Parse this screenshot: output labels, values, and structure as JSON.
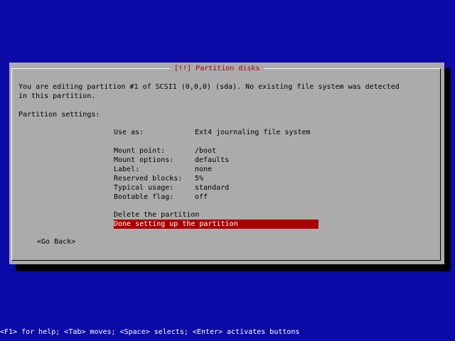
{
  "dialog": {
    "title": "[!!] Partition disks",
    "intro_line1": "You are editing partition #1 of SCSI1 (0,0,0) (sda). No existing file system was detected",
    "intro_line2": "in this partition.",
    "settings_heading": "Partition settings:",
    "options": [
      {
        "label": "Use as:",
        "value": "Ext4 journaling file system"
      },
      {
        "label": "Mount point:",
        "value": "/boot"
      },
      {
        "label": "Mount options:",
        "value": "defaults"
      },
      {
        "label": "Label:",
        "value": "none"
      },
      {
        "label": "Reserved blocks:",
        "value": "5%"
      },
      {
        "label": "Typical usage:",
        "value": "standard"
      },
      {
        "label": "Bootable flag:",
        "value": "off"
      }
    ],
    "actions": [
      {
        "label": "Delete the partition",
        "selected": false
      },
      {
        "label": "Done setting up the partition",
        "selected": true
      }
    ],
    "go_back": "<Go Back>"
  },
  "status_bar": {
    "help_text": "<F1> for help; <Tab> moves; <Space> selects; <Enter> activates buttons"
  },
  "colors": {
    "background": "#0b0ba8",
    "dialog": "#ababab",
    "title_text": "#a80000",
    "selection": "#a80000"
  }
}
